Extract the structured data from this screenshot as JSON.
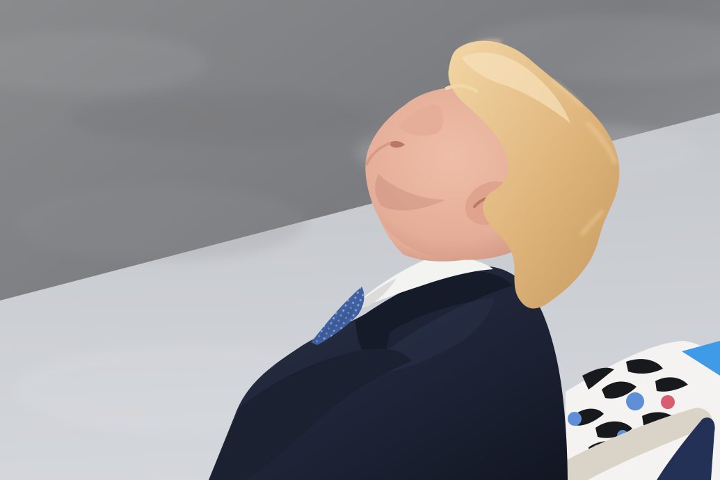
{
  "photo": {
    "description_visible_text": "",
    "colors": {
      "street_dark": "#7f8082",
      "street_light": "#c9ccd0",
      "sidewalk": "#d7dadf",
      "suit": "#1f2536",
      "suit_shadow": "#121622",
      "shirt": "#f3f3f1",
      "tie": "#41609f",
      "skin": "#e9b39d",
      "skin_shadow": "#c88f7d",
      "hair": "#e3bb84",
      "hair_highlight": "#f1d2a1",
      "chair_shell": "#d9d3c8",
      "chair_seat": "#233157",
      "floral_bg": "#f4f3f1",
      "floral_dark": "#18191c",
      "floral_blue": "#5f8fd6",
      "floral_red": "#d85d72",
      "floral_accent_blue": "#3f9be8"
    }
  }
}
